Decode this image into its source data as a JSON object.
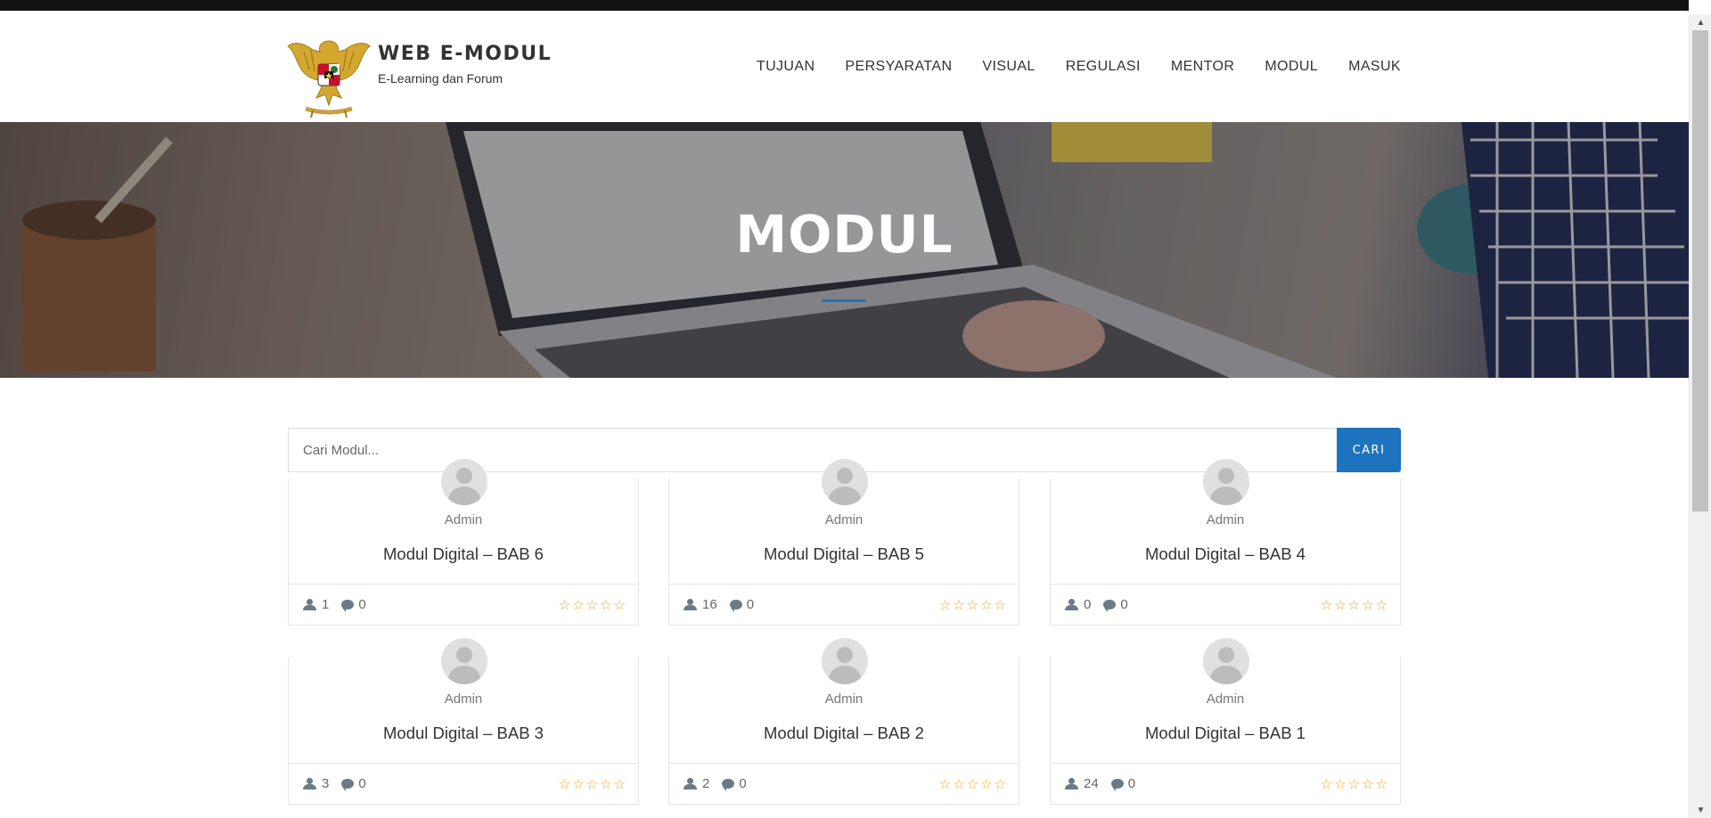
{
  "header": {
    "brand_title": "WEB E-MODUL",
    "brand_subtitle": "E-Learning dan Forum",
    "nav": [
      "TUJUAN",
      "PERSYARATAN",
      "VISUAL",
      "REGULASI",
      "MENTOR",
      "MODUL",
      "MASUK"
    ]
  },
  "hero": {
    "title": "MODUL"
  },
  "search": {
    "placeholder": "Cari Modul...",
    "button_label": "CARI"
  },
  "colors": {
    "accent": "#1e73be",
    "star": "#f0a020"
  },
  "cards": [
    {
      "author": "Admin",
      "title": "Modul Digital – BAB 6",
      "members": "1",
      "comments": "0",
      "rating_stars": 5
    },
    {
      "author": "Admin",
      "title": "Modul Digital – BAB 5",
      "members": "16",
      "comments": "0",
      "rating_stars": 5
    },
    {
      "author": "Admin",
      "title": "Modul Digital – BAB 4",
      "members": "0",
      "comments": "0",
      "rating_stars": 5
    },
    {
      "author": "Admin",
      "title": "Modul Digital – BAB 3",
      "members": "3",
      "comments": "0",
      "rating_stars": 5
    },
    {
      "author": "Admin",
      "title": "Modul Digital – BAB 2",
      "members": "2",
      "comments": "0",
      "rating_stars": 5
    },
    {
      "author": "Admin",
      "title": "Modul Digital – BAB 1",
      "members": "24",
      "comments": "0",
      "rating_stars": 5
    }
  ]
}
